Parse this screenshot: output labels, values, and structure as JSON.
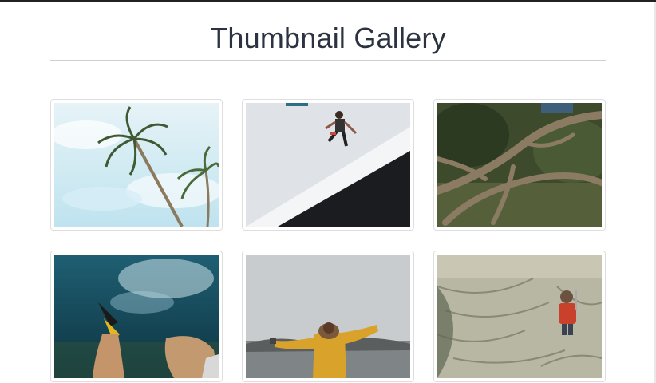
{
  "page": {
    "title": "Thumbnail Gallery"
  },
  "gallery": {
    "thumbnails": [
      {
        "name": "thumbnail-palm-trees",
        "subject": "palm trees against sky"
      },
      {
        "name": "thumbnail-jumping-man",
        "subject": "man jumping over white wall"
      },
      {
        "name": "thumbnail-tree-branches",
        "subject": "twisted tree branches"
      },
      {
        "name": "thumbnail-underwater-swimmer",
        "subject": "underwater swimmer legs with fins"
      },
      {
        "name": "thumbnail-woman-arms-out",
        "subject": "person in yellow jacket with arms out"
      },
      {
        "name": "thumbnail-child-in-grass",
        "subject": "child in red jacket in tall grass"
      }
    ]
  }
}
